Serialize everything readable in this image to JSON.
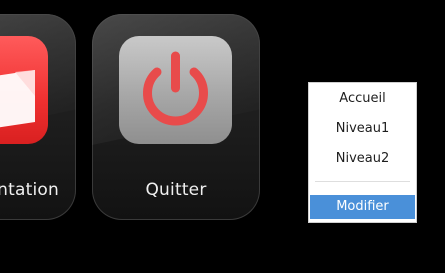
{
  "tiles": [
    {
      "label": "ntation",
      "icon": "presentation-icon",
      "color": "#ef3030"
    },
    {
      "label": "Quitter",
      "icon": "power-icon",
      "color": "#e84b4b"
    }
  ],
  "context_menu": {
    "items": [
      "Accueil",
      "Niveau1",
      "Niveau2"
    ],
    "selected_item": "Modifier",
    "selected_color": "#4a90d9"
  }
}
